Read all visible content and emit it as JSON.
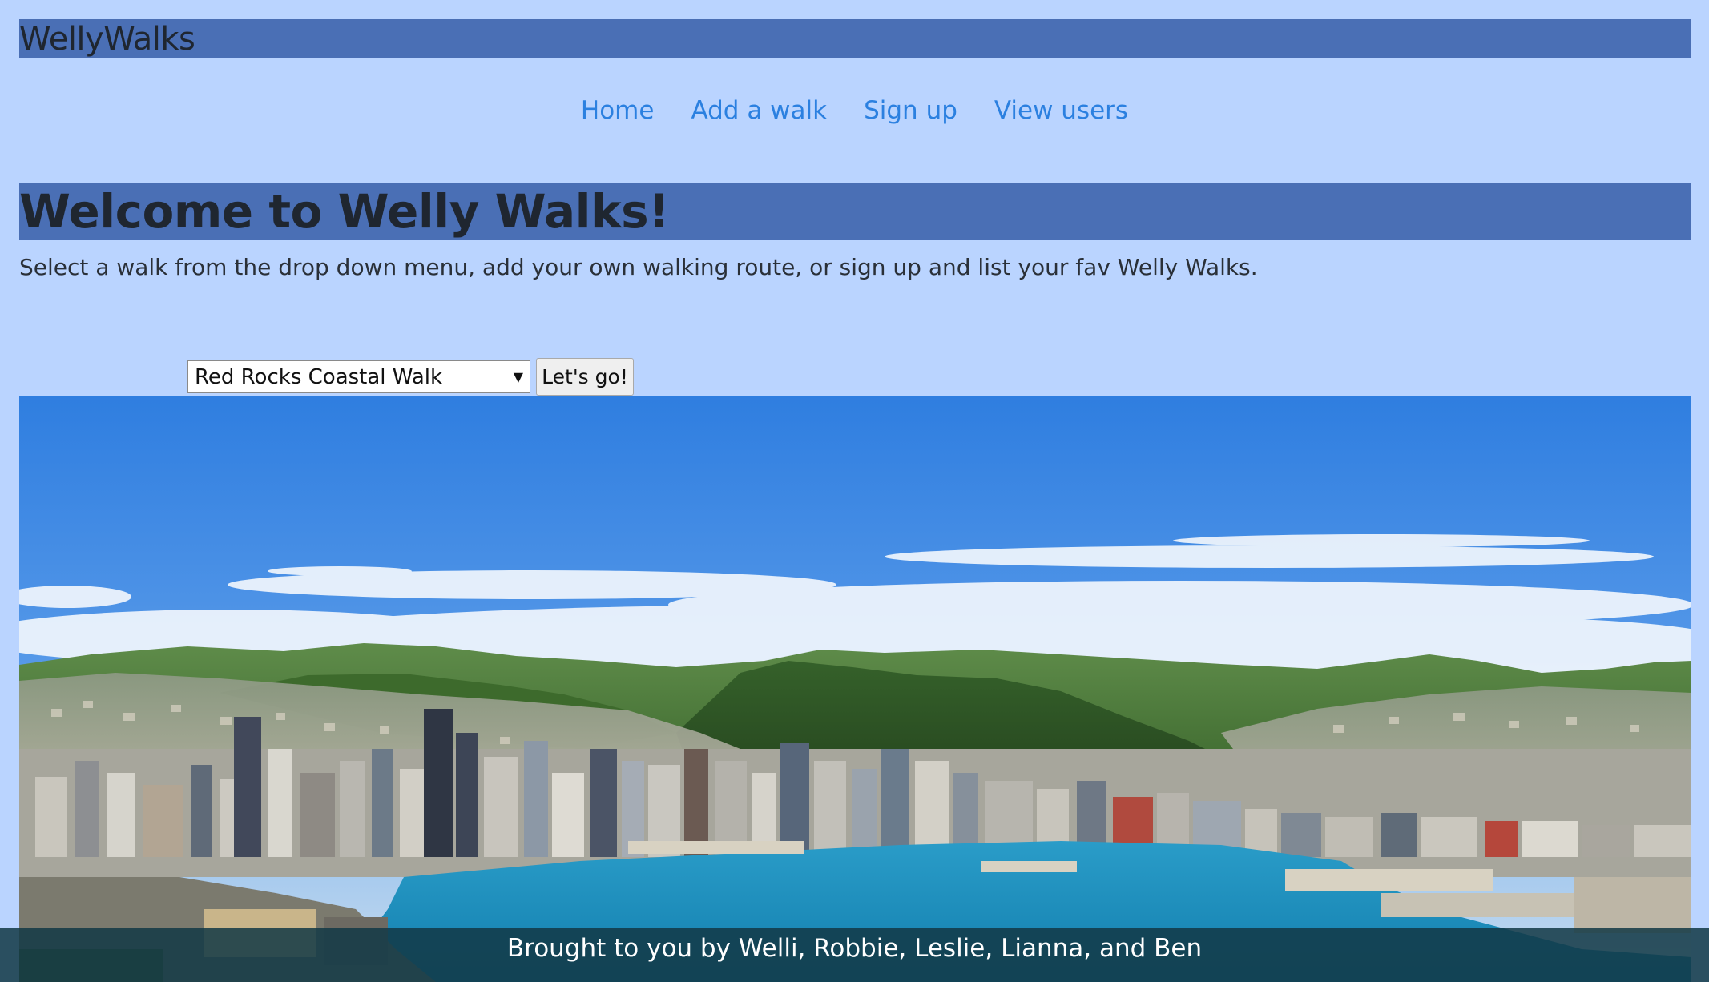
{
  "brand": {
    "title": "WellyWalks"
  },
  "nav": {
    "items": [
      {
        "label": "Home"
      },
      {
        "label": "Add a walk"
      },
      {
        "label": "Sign up"
      },
      {
        "label": "View users"
      }
    ]
  },
  "welcome": {
    "heading": "Welcome to Welly Walks!",
    "intro": "Select a walk from the drop down menu, add your own walking route, or sign up and list your fav Welly Walks."
  },
  "walk_picker": {
    "selected": "Red Rocks Coastal Walk",
    "button_label": "Let's go!"
  },
  "footer": {
    "text": "Brought to you by Welli, Robbie, Leslie, Lianna, and Ben"
  },
  "colors": {
    "page_background": "#bad4ff",
    "header_bar": "#4a6fb5",
    "nav_link": "#2b80e0",
    "footer_overlay": "#133946"
  }
}
